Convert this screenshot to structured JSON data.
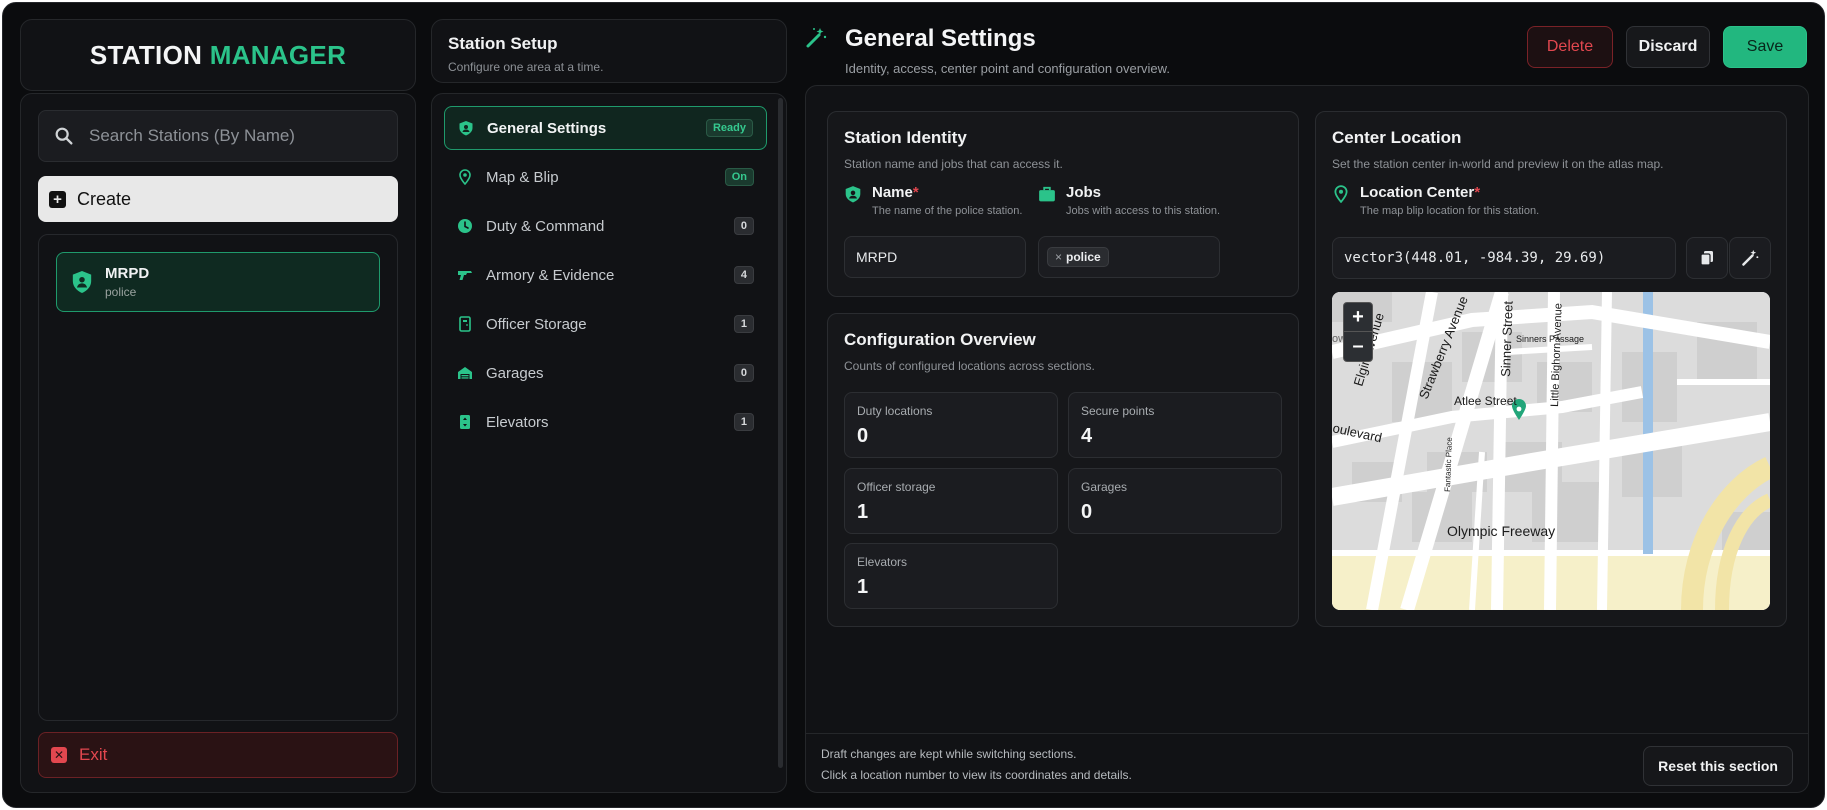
{
  "brand": {
    "part1": "STATION",
    "part2": "MANAGER"
  },
  "search": {
    "placeholder": "Search Stations (By Name)"
  },
  "create_label": "Create",
  "stations": [
    {
      "name": "MRPD",
      "job": "police"
    }
  ],
  "exit_label": "Exit",
  "setup": {
    "title": "Station Setup",
    "subtitle": "Configure one area at a time."
  },
  "nav": [
    {
      "label": "General Settings",
      "badge": "Ready",
      "icon": "shield-icon"
    },
    {
      "label": "Map & Blip",
      "badge": "On",
      "icon": "map-pin-icon"
    },
    {
      "label": "Duty & Command",
      "badge": "0",
      "icon": "clock-icon"
    },
    {
      "label": "Armory & Evidence",
      "badge": "4",
      "icon": "gun-icon"
    },
    {
      "label": "Officer Storage",
      "badge": "1",
      "icon": "locker-icon"
    },
    {
      "label": "Garages",
      "badge": "0",
      "icon": "garage-icon"
    },
    {
      "label": "Elevators",
      "badge": "1",
      "icon": "elevator-icon"
    }
  ],
  "header": {
    "title": "General Settings",
    "subtitle": "Identity, access, center point and configuration overview.",
    "delete_label": "Delete",
    "discard_label": "Discard",
    "save_label": "Save"
  },
  "identity": {
    "title": "Station Identity",
    "subtitle": "Station name and jobs that can access it.",
    "name_label": "Name",
    "name_required": "*",
    "name_desc": "The name of the police station.",
    "name_value": "MRPD",
    "jobs_label": "Jobs",
    "jobs_desc": "Jobs with access to this station.",
    "job_chip": "police",
    "chip_remove": "×"
  },
  "overview": {
    "title": "Configuration Overview",
    "subtitle": "Counts of configured locations across sections.",
    "stats": [
      {
        "label": "Duty locations",
        "value": "0"
      },
      {
        "label": "Secure points",
        "value": "4"
      },
      {
        "label": "Officer storage",
        "value": "1"
      },
      {
        "label": "Garages",
        "value": "0"
      },
      {
        "label": "Elevators",
        "value": "1"
      }
    ]
  },
  "center": {
    "title": "Center Location",
    "subtitle": "Set the station center in-world and preview it on the atlas map.",
    "label": "Location Center",
    "required": "*",
    "desc": "The map blip location for this station.",
    "value": "vector3(448.01, -984.39, 29.69)"
  },
  "map": {
    "zoom_in": "+",
    "zoom_out": "–",
    "streets": [
      "Elgin Avenue",
      "Strawberry Avenue",
      "Sinner Street",
      "Sinners Passage",
      "Little Bighorn Avenue",
      "Atlee Street",
      "oulevard",
      "Fantastic Place",
      "Olympic Freeway",
      "ow"
    ]
  },
  "footer": {
    "line1": "Draft changes are kept while switching sections.",
    "line2": "Click a location number to view its coordinates and details.",
    "reset_label": "Reset this section"
  },
  "colors": {
    "accent": "#2bc38a",
    "danger": "#e2474f",
    "background": "#0b0c0e"
  }
}
